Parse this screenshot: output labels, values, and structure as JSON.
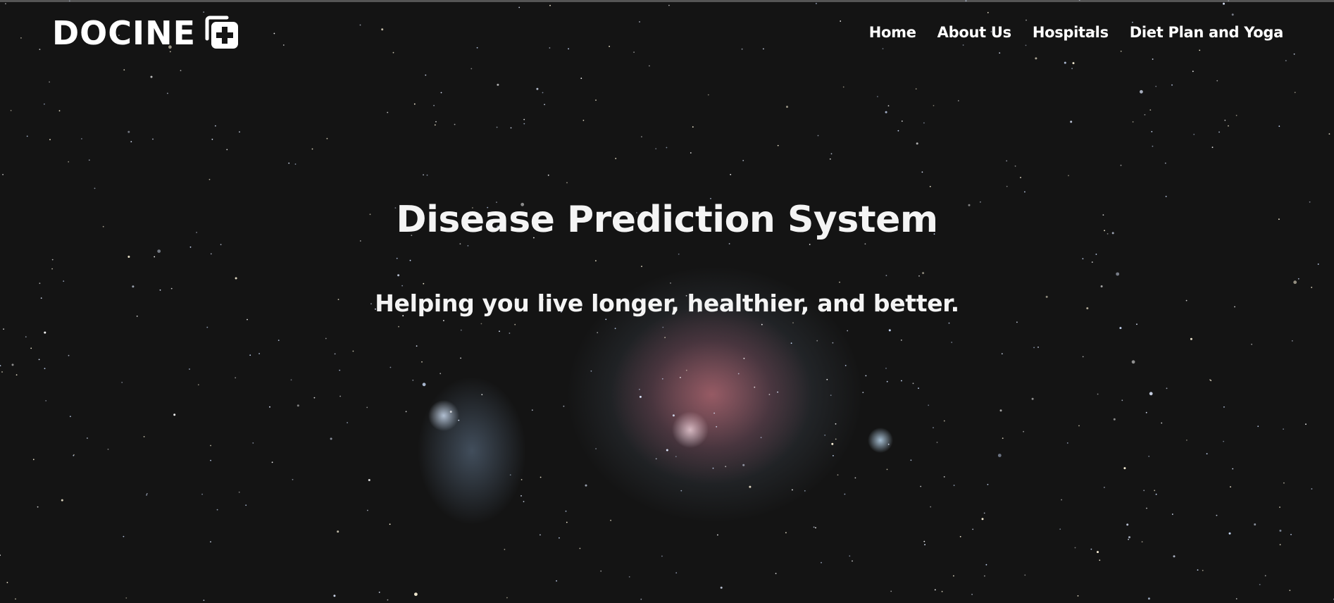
{
  "brand": {
    "name": "DOCINE",
    "icon": "medical-plus-icon"
  },
  "nav": {
    "items": [
      {
        "label": "Home"
      },
      {
        "label": "About Us"
      },
      {
        "label": "Hospitals"
      },
      {
        "label": "Diet Plan and Yoga"
      }
    ]
  },
  "hero": {
    "title": "Disease Prediction System",
    "subtitle": "Helping you live longer, healthier, and better.",
    "background": "orion-nebula-starfield"
  },
  "colors": {
    "text": "#ffffff",
    "background": "#141414"
  }
}
